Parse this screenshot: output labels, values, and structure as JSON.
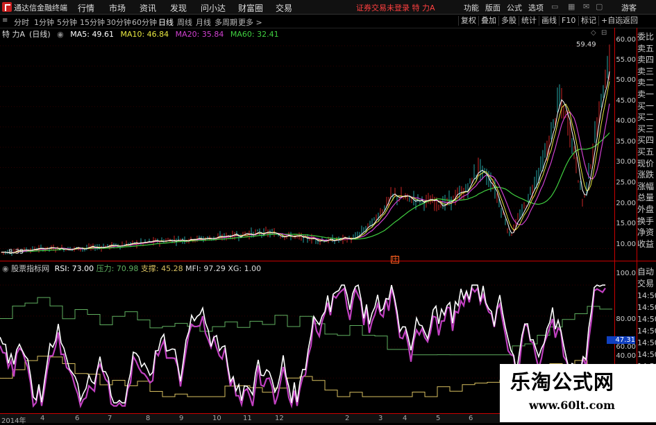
{
  "app": {
    "title": "通达信金融终端",
    "status": "证券交易未登录 特 力A"
  },
  "menu": [
    "行情",
    "市场",
    "资讯",
    "发现",
    "问小达",
    "财富圈",
    "交易"
  ],
  "right_menu": [
    "功能",
    "版面",
    "公式",
    "选项",
    "游客"
  ],
  "periods": [
    "分时",
    "1分钟",
    "5分钟",
    "15分钟",
    "30分钟",
    "60分钟",
    "日线",
    "周线",
    "月线",
    "多周期",
    "更多 >"
  ],
  "active_period": "日线",
  "toolbar": [
    "复权",
    "叠加",
    "多股",
    "统计",
    "画线",
    "F10",
    "标记",
    "+自选",
    "返回"
  ],
  "stock": {
    "name": "特 力A",
    "period_label": "(日线)"
  },
  "ma": {
    "ma5": "MA5: 49.61",
    "ma10": "MA10: 46.84",
    "ma20": "MA20: 35.84",
    "ma60": "MA60: 32.41"
  },
  "colors": {
    "ma5": "#ffffff",
    "ma10": "#e8e840",
    "ma20": "#d040d0",
    "ma60": "#40d040",
    "rsi": "#ffffff",
    "pressure": "#60b060",
    "support": "#d8c060",
    "mfi": "#c040c0"
  },
  "price_labels": {
    "high": "59.49",
    "low": "8.39"
  },
  "price_axis": [
    "60.00",
    "55.00",
    "50.00",
    "45.00",
    "40.00",
    "35.00",
    "30.00",
    "25.00",
    "20.00",
    "15.00",
    "10.00"
  ],
  "right_panel": [
    "委比",
    "卖五",
    "卖四",
    "卖三",
    "卖二",
    "卖一",
    "买一",
    "买二",
    "买三",
    "买四",
    "买五",
    "现价",
    "涨跌",
    "涨幅",
    "总量",
    "外盘",
    "换手",
    "净资",
    "收益"
  ],
  "right_panel_lower": [
    "自动",
    "交易",
    "14:50",
    "14:50",
    "14:50",
    "14:50",
    "14:50",
    "14:50",
    "14:50"
  ],
  "indicator": {
    "name": "股票指标网",
    "rsi": "RSI: 73.00",
    "pressure": "压力: 70.98",
    "support": "支撑: 45.28",
    "mfi": "MFI: 97.29",
    "xg": "XG: 1.00"
  },
  "ind_axis": [
    "100.0",
    "80.00",
    "60.00",
    "40.00"
  ],
  "ind_value": "47.31",
  "marker": "庄",
  "time_ticks": [
    "2014年",
    "4",
    "6",
    "7",
    "8",
    "9",
    "10",
    "11",
    "12",
    "2",
    "3",
    "4",
    "5",
    "6"
  ],
  "watermark": {
    "line1": "乐淘公式网",
    "line2": "www.60lt.com"
  }
}
